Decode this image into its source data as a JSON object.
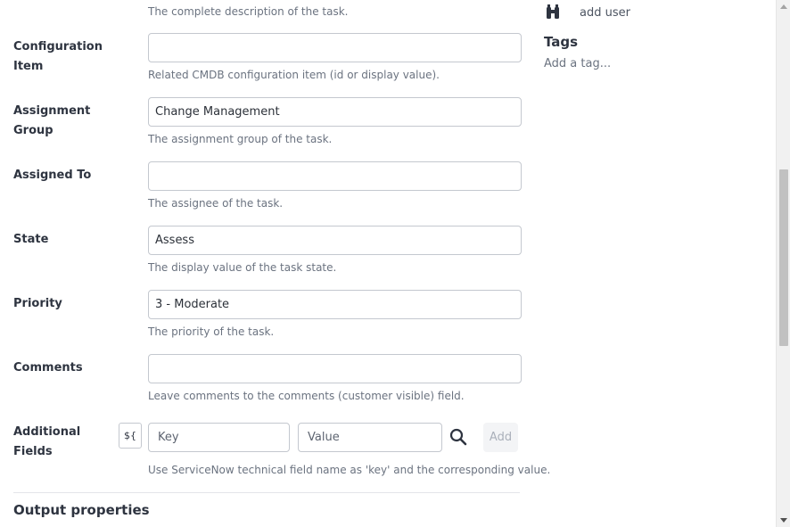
{
  "top_description": "The complete description of the task.",
  "fields": {
    "configuration_item": {
      "label_line1": "Configuration",
      "label_line2": "Item",
      "value": "",
      "help": "Related CMDB configuration item (id or display value)."
    },
    "assignment_group": {
      "label_line1": "Assignment",
      "label_line2": "Group",
      "value": "Change Management",
      "help": "The assignment group of the task."
    },
    "assigned_to": {
      "label": "Assigned To",
      "value": "",
      "help": "The assignee of the task."
    },
    "state": {
      "label": "State",
      "value": "Assess",
      "help": "The display value of the task state."
    },
    "priority": {
      "label": "Priority",
      "value": "3 - Moderate",
      "help": "The priority of the task."
    },
    "comments": {
      "label": "Comments",
      "value": "",
      "help": "Leave comments to the comments (customer visible) field."
    },
    "additional_fields": {
      "label": "Additional Fields",
      "variable_button": "${",
      "key_placeholder": "Key",
      "value_placeholder": "Value",
      "add_label": "Add",
      "help": "Use ServiceNow technical field name as 'key' and the corresponding value."
    }
  },
  "output_section_title": "Output properties",
  "sidebar": {
    "add_user_label": "add user",
    "add_user_icon": "binoculars-icon",
    "tags_title": "Tags",
    "add_tag_label": "Add a tag..."
  },
  "colors": {
    "input_border": "#c4c8cf",
    "help_text": "#6b7380",
    "add_button_bg": "#f3f4f6"
  }
}
